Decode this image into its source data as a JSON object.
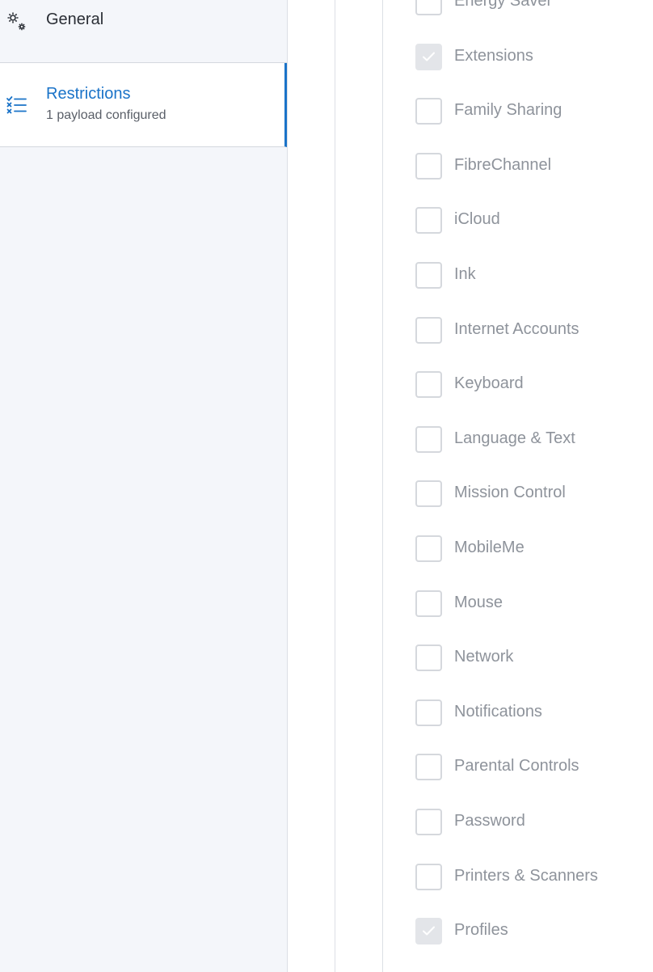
{
  "sidebar": {
    "general": {
      "label": "General",
      "icon": "gears-icon"
    },
    "restrictions": {
      "label": "Restrictions",
      "sublabel": "1 payload configured",
      "icon": "checklist-icon",
      "accent": "#1a73c8"
    }
  },
  "restrictions_list": {
    "items": [
      {
        "label": "Energy Saver",
        "checked": false
      },
      {
        "label": "Extensions",
        "checked": true
      },
      {
        "label": "Family Sharing",
        "checked": false
      },
      {
        "label": "FibreChannel",
        "checked": false
      },
      {
        "label": "iCloud",
        "checked": false
      },
      {
        "label": "Ink",
        "checked": false
      },
      {
        "label": "Internet Accounts",
        "checked": false
      },
      {
        "label": "Keyboard",
        "checked": false
      },
      {
        "label": "Language & Text",
        "checked": false
      },
      {
        "label": "Mission Control",
        "checked": false
      },
      {
        "label": "MobileMe",
        "checked": false
      },
      {
        "label": "Mouse",
        "checked": false
      },
      {
        "label": "Network",
        "checked": false
      },
      {
        "label": "Notifications",
        "checked": false
      },
      {
        "label": "Parental Controls",
        "checked": false
      },
      {
        "label": "Password",
        "checked": false
      },
      {
        "label": "Printers & Scanners",
        "checked": false
      },
      {
        "label": "Profiles",
        "checked": true
      }
    ]
  }
}
